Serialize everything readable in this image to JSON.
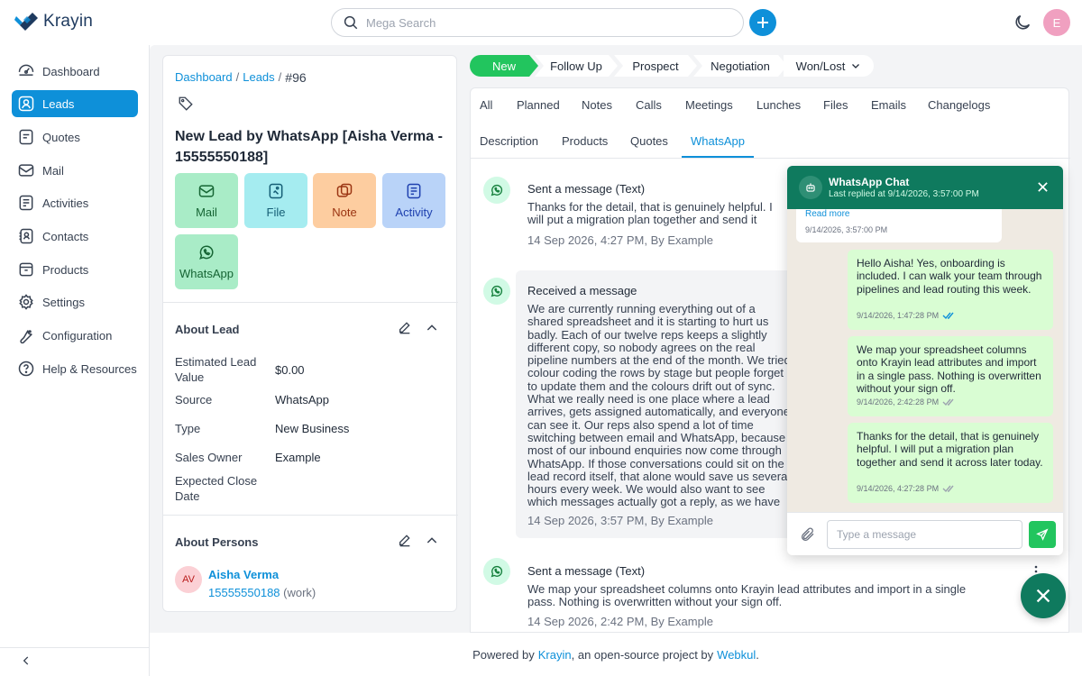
{
  "header": {
    "logo_text": "Krayin",
    "search_placeholder": "Mega Search",
    "avatar_initial": "E"
  },
  "sidebar": {
    "items": [
      {
        "label": "Dashboard",
        "icon": "dashboard-icon"
      },
      {
        "label": "Leads",
        "icon": "leads-icon",
        "active": true
      },
      {
        "label": "Quotes",
        "icon": "quotes-icon"
      },
      {
        "label": "Mail",
        "icon": "mail-icon"
      },
      {
        "label": "Activities",
        "icon": "activities-icon"
      },
      {
        "label": "Contacts",
        "icon": "contacts-icon"
      },
      {
        "label": "Products",
        "icon": "products-icon"
      },
      {
        "label": "Settings",
        "icon": "settings-icon"
      },
      {
        "label": "Configuration",
        "icon": "configuration-icon"
      },
      {
        "label": "Help & Resources",
        "icon": "help-icon"
      }
    ]
  },
  "lead": {
    "breadcrumb": {
      "dashboard": "Dashboard",
      "leads": "Leads",
      "id": "#96",
      "sep": "/"
    },
    "title": "New Lead by WhatsApp [Aisha Verma - 15555550188]",
    "actions": {
      "mail": "Mail",
      "file": "File",
      "note": "Note",
      "activity": "Activity",
      "whatsapp": "WhatsApp"
    },
    "about_lead": {
      "title": "About Lead",
      "fields": [
        {
          "label": "Estimated Lead Value",
          "value": "$0.00"
        },
        {
          "label": "Source",
          "value": "WhatsApp"
        },
        {
          "label": "Type",
          "value": "New Business"
        },
        {
          "label": "Sales Owner",
          "value": "Example"
        },
        {
          "label": "Expected Close Date",
          "value": ""
        }
      ]
    },
    "about_persons": {
      "title": "About Persons",
      "person": {
        "initials": "AV",
        "name": "Aisha Verma",
        "phone": "15555550188",
        "phone_type": "(work)"
      }
    }
  },
  "stages": [
    {
      "label": "New",
      "active": true
    },
    {
      "label": "Follow Up"
    },
    {
      "label": "Prospect"
    },
    {
      "label": "Negotiation"
    },
    {
      "label": "Won/Lost"
    }
  ],
  "tabs_row1": [
    "All",
    "Planned",
    "Notes",
    "Calls",
    "Meetings",
    "Lunches",
    "Files",
    "Emails",
    "Changelogs"
  ],
  "tabs_row2": [
    "Description",
    "Products",
    "Quotes",
    "WhatsApp"
  ],
  "activities": [
    {
      "title": "Sent a message (Text)",
      "body": "Thanks for the detail, that is genuinely helpful. I will put a migration plan together and send it across later today.",
      "meta": "14 Sep 2026, 4:27 PM, By Example"
    },
    {
      "title": "Received a message",
      "body": "We are currently running everything out of a shared spreadsheet and it is starting to hurt us badly. Each of our twelve reps keeps a slightly different copy, so nobody agrees on the real pipeline numbers at the end of the month. We tried colour coding the rows by stage but people forget to update them and the colours drift out of sync. What we really need is one place where a lead arrives, gets assigned automatically, and everyone can see it. Our reps also spend a lot of time switching between email and WhatsApp, because most of our inbound enquiries now come through WhatsApp. If those conversations could sit on the lead record itself, that alone would save us several hours every week. We would also want to see which messages actually got a reply, as we have had cases where a quote was never delivered and nobody noticed. Could you tell me whether Krayin handles all of that out of the box, or would it need something built on top of it? One more thing worth mentioning is that our manager builds the same pivot table every Monday morning, and it takes longer than anyone can look at it. If Krayin can show won and lost value per rep directly, that would pay for itself in saved time alone. We are also keen that old messages stay searchable, because we often need to find an old conversation later.",
      "meta": "14 Sep 2026, 3:57 PM, By Example"
    },
    {
      "title": "Sent a message (Text)",
      "body": "We map your spreadsheet columns onto Krayin lead attributes and import in a single pass. Nothing is overwritten without your sign off.",
      "meta": "14 Sep 2026, 2:42 PM, By Example"
    }
  ],
  "chat": {
    "title": "WhatsApp Chat",
    "subtitle": "Last replied at 9/14/2026, 3:57:00 PM",
    "read_more": "Read more",
    "in_time": "9/14/2026, 3:57:00 PM",
    "messages": [
      {
        "text": "Hello Aisha! Yes, onboarding is included. I can walk your team through pipelines and lead routing this week.",
        "time": "9/14/2026, 1:47:28 PM",
        "status": "read"
      },
      {
        "text": "We map your spreadsheet columns onto Krayin lead attributes and import in a single pass. Nothing is overwritten without your sign off.",
        "time": "9/14/2026, 2:42:28 PM",
        "status": "delivered"
      },
      {
        "text": "Thanks for the detail, that is genuinely helpful. I will put a migration plan together and send it across later today.",
        "time": "9/14/2026, 4:27:28 PM",
        "status": "delivered"
      }
    ],
    "input_placeholder": "Type a message"
  },
  "footer": {
    "prefix": "Powered by",
    "krayin": "Krayin",
    "middle": ", an open-source project by",
    "webkul": "Webkul",
    "suffix": "."
  },
  "colors": {
    "accent": "#0e90d9",
    "stage_active": "#22c55e",
    "chat_header": "#0f7a5e"
  }
}
